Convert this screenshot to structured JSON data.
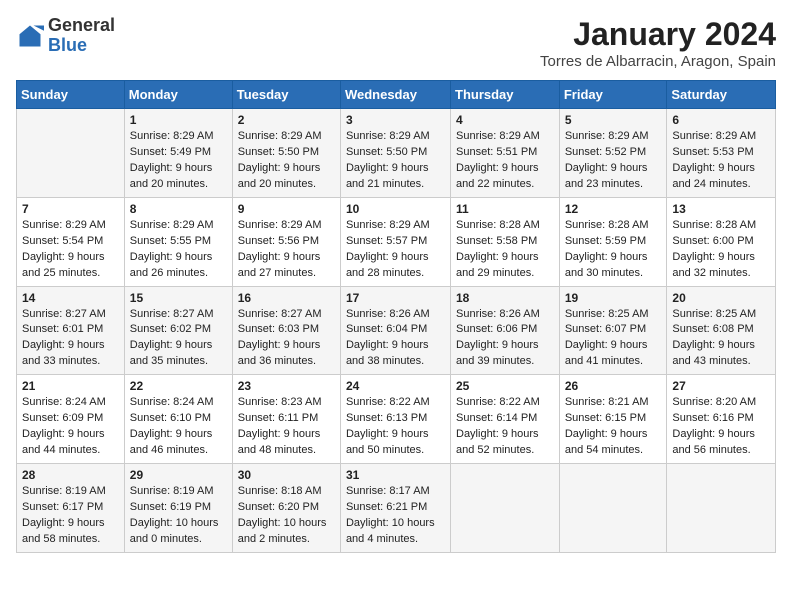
{
  "header": {
    "logo_general": "General",
    "logo_blue": "Blue",
    "month_year": "January 2024",
    "location": "Torres de Albarracin, Aragon, Spain"
  },
  "weekdays": [
    "Sunday",
    "Monday",
    "Tuesday",
    "Wednesday",
    "Thursday",
    "Friday",
    "Saturday"
  ],
  "weeks": [
    [
      {
        "day": "",
        "sunrise": "",
        "sunset": "",
        "daylight": ""
      },
      {
        "day": "1",
        "sunrise": "Sunrise: 8:29 AM",
        "sunset": "Sunset: 5:49 PM",
        "daylight": "Daylight: 9 hours and 20 minutes."
      },
      {
        "day": "2",
        "sunrise": "Sunrise: 8:29 AM",
        "sunset": "Sunset: 5:50 PM",
        "daylight": "Daylight: 9 hours and 20 minutes."
      },
      {
        "day": "3",
        "sunrise": "Sunrise: 8:29 AM",
        "sunset": "Sunset: 5:50 PM",
        "daylight": "Daylight: 9 hours and 21 minutes."
      },
      {
        "day": "4",
        "sunrise": "Sunrise: 8:29 AM",
        "sunset": "Sunset: 5:51 PM",
        "daylight": "Daylight: 9 hours and 22 minutes."
      },
      {
        "day": "5",
        "sunrise": "Sunrise: 8:29 AM",
        "sunset": "Sunset: 5:52 PM",
        "daylight": "Daylight: 9 hours and 23 minutes."
      },
      {
        "day": "6",
        "sunrise": "Sunrise: 8:29 AM",
        "sunset": "Sunset: 5:53 PM",
        "daylight": "Daylight: 9 hours and 24 minutes."
      }
    ],
    [
      {
        "day": "7",
        "sunrise": "Sunrise: 8:29 AM",
        "sunset": "Sunset: 5:54 PM",
        "daylight": "Daylight: 9 hours and 25 minutes."
      },
      {
        "day": "8",
        "sunrise": "Sunrise: 8:29 AM",
        "sunset": "Sunset: 5:55 PM",
        "daylight": "Daylight: 9 hours and 26 minutes."
      },
      {
        "day": "9",
        "sunrise": "Sunrise: 8:29 AM",
        "sunset": "Sunset: 5:56 PM",
        "daylight": "Daylight: 9 hours and 27 minutes."
      },
      {
        "day": "10",
        "sunrise": "Sunrise: 8:29 AM",
        "sunset": "Sunset: 5:57 PM",
        "daylight": "Daylight: 9 hours and 28 minutes."
      },
      {
        "day": "11",
        "sunrise": "Sunrise: 8:28 AM",
        "sunset": "Sunset: 5:58 PM",
        "daylight": "Daylight: 9 hours and 29 minutes."
      },
      {
        "day": "12",
        "sunrise": "Sunrise: 8:28 AM",
        "sunset": "Sunset: 5:59 PM",
        "daylight": "Daylight: 9 hours and 30 minutes."
      },
      {
        "day": "13",
        "sunrise": "Sunrise: 8:28 AM",
        "sunset": "Sunset: 6:00 PM",
        "daylight": "Daylight: 9 hours and 32 minutes."
      }
    ],
    [
      {
        "day": "14",
        "sunrise": "Sunrise: 8:27 AM",
        "sunset": "Sunset: 6:01 PM",
        "daylight": "Daylight: 9 hours and 33 minutes."
      },
      {
        "day": "15",
        "sunrise": "Sunrise: 8:27 AM",
        "sunset": "Sunset: 6:02 PM",
        "daylight": "Daylight: 9 hours and 35 minutes."
      },
      {
        "day": "16",
        "sunrise": "Sunrise: 8:27 AM",
        "sunset": "Sunset: 6:03 PM",
        "daylight": "Daylight: 9 hours and 36 minutes."
      },
      {
        "day": "17",
        "sunrise": "Sunrise: 8:26 AM",
        "sunset": "Sunset: 6:04 PM",
        "daylight": "Daylight: 9 hours and 38 minutes."
      },
      {
        "day": "18",
        "sunrise": "Sunrise: 8:26 AM",
        "sunset": "Sunset: 6:06 PM",
        "daylight": "Daylight: 9 hours and 39 minutes."
      },
      {
        "day": "19",
        "sunrise": "Sunrise: 8:25 AM",
        "sunset": "Sunset: 6:07 PM",
        "daylight": "Daylight: 9 hours and 41 minutes."
      },
      {
        "day": "20",
        "sunrise": "Sunrise: 8:25 AM",
        "sunset": "Sunset: 6:08 PM",
        "daylight": "Daylight: 9 hours and 43 minutes."
      }
    ],
    [
      {
        "day": "21",
        "sunrise": "Sunrise: 8:24 AM",
        "sunset": "Sunset: 6:09 PM",
        "daylight": "Daylight: 9 hours and 44 minutes."
      },
      {
        "day": "22",
        "sunrise": "Sunrise: 8:24 AM",
        "sunset": "Sunset: 6:10 PM",
        "daylight": "Daylight: 9 hours and 46 minutes."
      },
      {
        "day": "23",
        "sunrise": "Sunrise: 8:23 AM",
        "sunset": "Sunset: 6:11 PM",
        "daylight": "Daylight: 9 hours and 48 minutes."
      },
      {
        "day": "24",
        "sunrise": "Sunrise: 8:22 AM",
        "sunset": "Sunset: 6:13 PM",
        "daylight": "Daylight: 9 hours and 50 minutes."
      },
      {
        "day": "25",
        "sunrise": "Sunrise: 8:22 AM",
        "sunset": "Sunset: 6:14 PM",
        "daylight": "Daylight: 9 hours and 52 minutes."
      },
      {
        "day": "26",
        "sunrise": "Sunrise: 8:21 AM",
        "sunset": "Sunset: 6:15 PM",
        "daylight": "Daylight: 9 hours and 54 minutes."
      },
      {
        "day": "27",
        "sunrise": "Sunrise: 8:20 AM",
        "sunset": "Sunset: 6:16 PM",
        "daylight": "Daylight: 9 hours and 56 minutes."
      }
    ],
    [
      {
        "day": "28",
        "sunrise": "Sunrise: 8:19 AM",
        "sunset": "Sunset: 6:17 PM",
        "daylight": "Daylight: 9 hours and 58 minutes."
      },
      {
        "day": "29",
        "sunrise": "Sunrise: 8:19 AM",
        "sunset": "Sunset: 6:19 PM",
        "daylight": "Daylight: 10 hours and 0 minutes."
      },
      {
        "day": "30",
        "sunrise": "Sunrise: 8:18 AM",
        "sunset": "Sunset: 6:20 PM",
        "daylight": "Daylight: 10 hours and 2 minutes."
      },
      {
        "day": "31",
        "sunrise": "Sunrise: 8:17 AM",
        "sunset": "Sunset: 6:21 PM",
        "daylight": "Daylight: 10 hours and 4 minutes."
      },
      {
        "day": "",
        "sunrise": "",
        "sunset": "",
        "daylight": ""
      },
      {
        "day": "",
        "sunrise": "",
        "sunset": "",
        "daylight": ""
      },
      {
        "day": "",
        "sunrise": "",
        "sunset": "",
        "daylight": ""
      }
    ]
  ]
}
